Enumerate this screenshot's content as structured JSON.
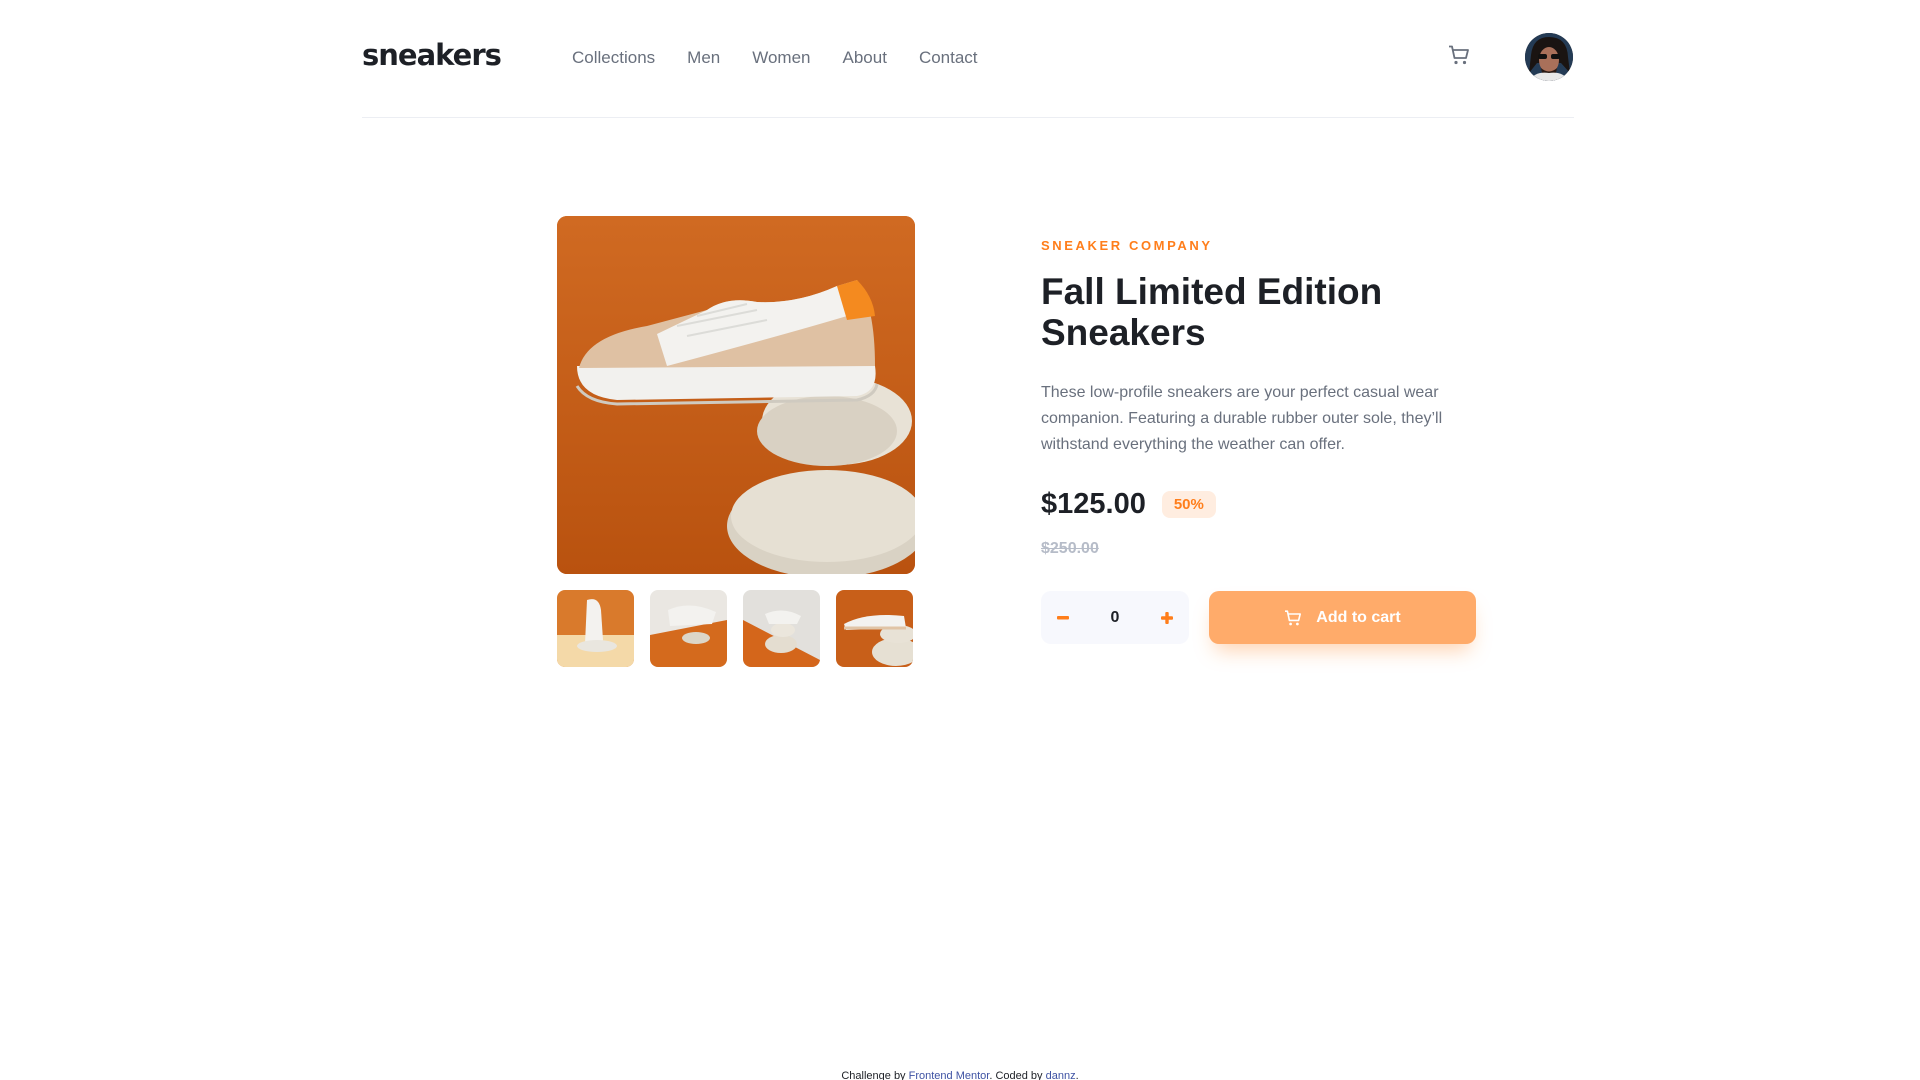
{
  "header": {
    "logo": "sneakers",
    "nav": [
      {
        "label": "Collections"
      },
      {
        "label": "Men"
      },
      {
        "label": "Women"
      },
      {
        "label": "About"
      },
      {
        "label": "Contact"
      }
    ],
    "cart_icon": "cart-icon",
    "avatar_icon": "avatar"
  },
  "gallery": {
    "main_image": "product-image-sneaker-on-stones",
    "thumbnails": [
      {
        "name": "thumbnail-1"
      },
      {
        "name": "thumbnail-2"
      },
      {
        "name": "thumbnail-3"
      },
      {
        "name": "thumbnail-4"
      }
    ]
  },
  "product": {
    "company": "SNEAKER COMPANY",
    "title_line1": "Fall Limited Edition",
    "title_line2": "Sneakers",
    "description": "These low-profile sneakers are your perfect casual wear companion. Featuring a durable rubber outer sole, they’ll withstand everything the weather can offer.",
    "price": "$125.00",
    "discount": "50%",
    "original_price": "$250.00",
    "quantity": "0",
    "add_to_cart_label": "Add to cart"
  },
  "footer": {
    "text_1": "Challenge by ",
    "link_1": "Frontend Mentor",
    "text_2": ". Coded by ",
    "link_2": "dannz",
    "text_3": "."
  },
  "colors": {
    "accent": "#ff7e1b",
    "accent_light": "#ffab6a",
    "badge_bg": "#ffede0",
    "text_dark": "#1d2026",
    "text_muted": "#69707d"
  }
}
